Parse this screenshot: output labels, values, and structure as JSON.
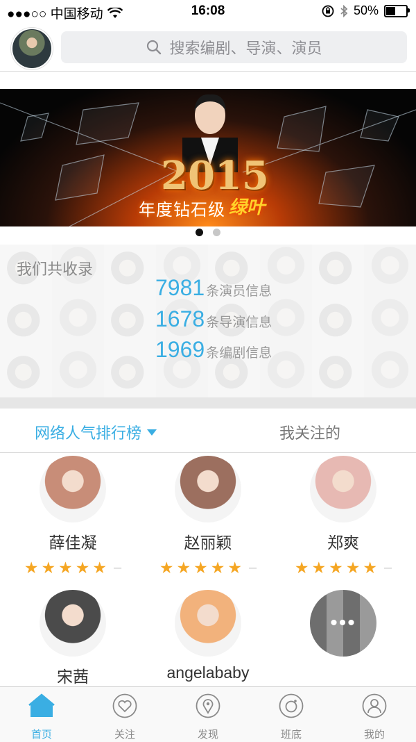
{
  "status_bar": {
    "carrier": "●●●○○ 中国移动",
    "time": "16:08",
    "battery": "50%",
    "battery_level": 0.5
  },
  "header": {
    "search_placeholder": "搜索编剧、导演、演员"
  },
  "banner": {
    "year": "2015",
    "caption": "年度钻石级",
    "caption_highlight": "绿叶",
    "page_count": 2,
    "active_page": 0
  },
  "stats": {
    "title": "我们共收录",
    "rows": [
      {
        "count": "7981",
        "unit": "条演员信息"
      },
      {
        "count": "1678",
        "unit": "条导演信息"
      },
      {
        "count": "1969",
        "unit": "条编剧信息"
      }
    ]
  },
  "tabs": {
    "active": "网络人气排行榜",
    "inactive": "我关注的"
  },
  "ranking": [
    {
      "name": "薛佳凝",
      "rating": 5,
      "avatar_color": "#c88d78"
    },
    {
      "name": "赵丽颖",
      "rating": 5,
      "avatar_color": "#9c6f5f"
    },
    {
      "name": "郑爽",
      "rating": 5,
      "avatar_color": "#e7b9b3"
    },
    {
      "name": "宋茜",
      "avatar_color": "#4b4b4b"
    },
    {
      "name": "angelababy",
      "avatar_color": "#f2b27c"
    }
  ],
  "more_icon": "ellipsis-icon",
  "tabbar": [
    {
      "label": "首页",
      "icon": "home-icon"
    },
    {
      "label": "关注",
      "icon": "heart-icon"
    },
    {
      "label": "发现",
      "icon": "location-pin-icon"
    },
    {
      "label": "班底",
      "icon": "ring-icon"
    },
    {
      "label": "我的",
      "icon": "user-icon"
    }
  ],
  "colors": {
    "accent": "#3aaee3",
    "star": "#f5a623"
  }
}
